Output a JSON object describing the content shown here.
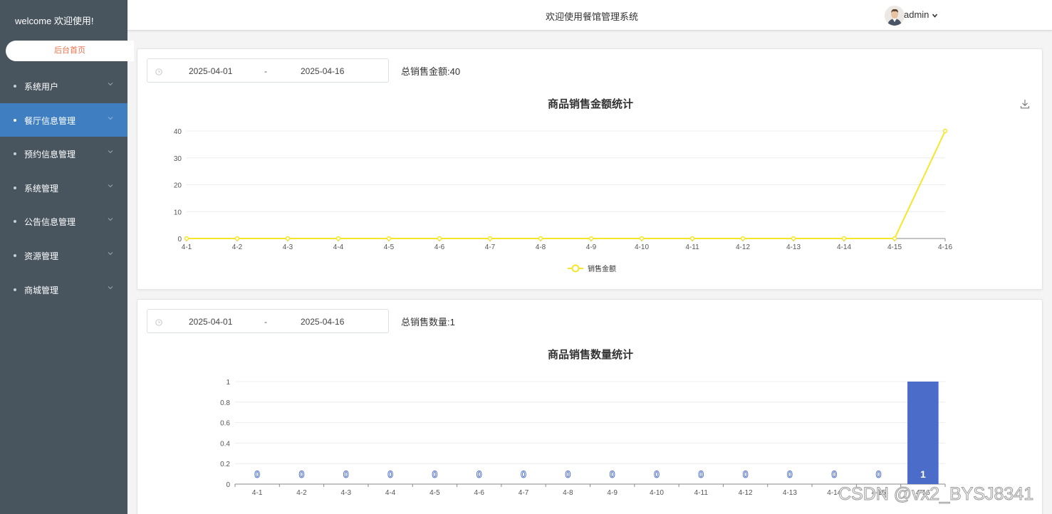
{
  "sidebar": {
    "welcome": "welcome 欢迎使用!",
    "home": "后台首页",
    "items": [
      {
        "label": "系统用户"
      },
      {
        "label": "餐厅信息管理"
      },
      {
        "label": "预约信息管理"
      },
      {
        "label": "系统管理"
      },
      {
        "label": "公告信息管理"
      },
      {
        "label": "资源管理"
      },
      {
        "label": "商城管理"
      }
    ]
  },
  "header": {
    "title": "欢迎使用餐馆管理系统",
    "username": "admin"
  },
  "sales_amount": {
    "start_date": "2025-04-01",
    "separator": "-",
    "end_date": "2025-04-16",
    "total_label": "总销售金额:",
    "total_value": "40"
  },
  "sales_qty": {
    "start_date": "2025-04-01",
    "separator": "-",
    "end_date": "2025-04-16",
    "total_label": "总销售数量:",
    "total_value": "1"
  },
  "chart_data": [
    {
      "type": "line",
      "title": "商品销售金额统计",
      "categories": [
        "4-1",
        "4-2",
        "4-3",
        "4-4",
        "4-5",
        "4-6",
        "4-7",
        "4-8",
        "4-9",
        "4-10",
        "4-11",
        "4-12",
        "4-13",
        "4-14",
        "4-15",
        "4-16"
      ],
      "series": [
        {
          "name": "销售金额",
          "values": [
            0,
            0,
            0,
            0,
            0,
            0,
            0,
            0,
            0,
            0,
            0,
            0,
            0,
            0,
            0,
            40
          ],
          "color": "#f5e62a"
        }
      ],
      "ylim": [
        0,
        40
      ],
      "yticks": [
        0,
        10,
        20,
        30,
        40
      ],
      "legend": "bottom-center",
      "grid": true
    },
    {
      "type": "bar",
      "title": "商品销售数量统计",
      "categories": [
        "4-1",
        "4-2",
        "4-3",
        "4-4",
        "4-5",
        "4-6",
        "4-7",
        "4-8",
        "4-9",
        "4-10",
        "4-11",
        "4-12",
        "4-13",
        "4-14",
        "4-15",
        "4-16"
      ],
      "series": [
        {
          "values": [
            0,
            0,
            0,
            0,
            0,
            0,
            0,
            0,
            0,
            0,
            0,
            0,
            0,
            0,
            0,
            1
          ],
          "color": "#4b6cc8"
        }
      ],
      "ylim": [
        0,
        1
      ],
      "yticks": [
        0,
        0.2,
        0.4,
        0.6,
        0.8,
        1
      ],
      "data_labels": true,
      "grid": true
    }
  ],
  "watermark": "CSDN @vx2_BYSJ8341"
}
